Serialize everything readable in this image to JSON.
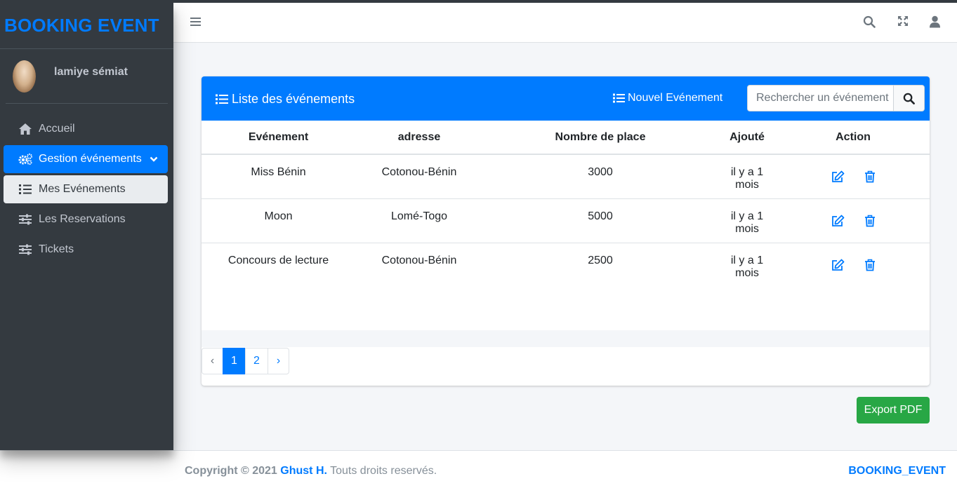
{
  "brand": {
    "title": "BOOKING EVENT"
  },
  "user": {
    "name": "lamiye sémiat"
  },
  "sidebar": {
    "items": [
      {
        "label": "Accueil",
        "icon": "home-icon"
      },
      {
        "label": "Gestion événements",
        "icon": "cogs-icon"
      },
      {
        "label": "Mes Evénements",
        "icon": "list-icon"
      },
      {
        "label": "Les Reservations",
        "icon": "sliders-icon"
      },
      {
        "label": "Tickets",
        "icon": "sliders-icon"
      }
    ]
  },
  "header": {
    "icons": [
      "menu-icon",
      "search-icon",
      "expand-icon",
      "user-icon"
    ]
  },
  "card": {
    "title": "Liste des événements",
    "new_event": "Nouvel Evénement",
    "search_placeholder": "Rechercher un événement",
    "columns": [
      "Evénement",
      "adresse",
      "Nombre de place",
      "Ajouté",
      "Action"
    ],
    "rows": [
      {
        "event": "Miss Bénin",
        "address": "Cotonou-Bénin",
        "places": "3000",
        "added": "il y a 1 mois"
      },
      {
        "event": "Moon",
        "address": "Lomé-Togo",
        "places": "5000",
        "added": "il y a 1 mois"
      },
      {
        "event": "Concours de lecture",
        "address": "Cotonou-Bénin",
        "places": "2500",
        "added": "il y a 1 mois"
      }
    ]
  },
  "pagination": {
    "prev": "‹",
    "pages": [
      "1",
      "2"
    ],
    "next": "›",
    "active": "1"
  },
  "export_button": "Export PDF",
  "footer": {
    "copyright_prefix": "Copyright © 2021",
    "author": "Ghust H.",
    "rights": "Touts droits reservés.",
    "brand": "BOOKING_EVENT"
  },
  "colors": {
    "primary": "#007bff",
    "sidebar": "#343a40",
    "success": "#28a745"
  }
}
